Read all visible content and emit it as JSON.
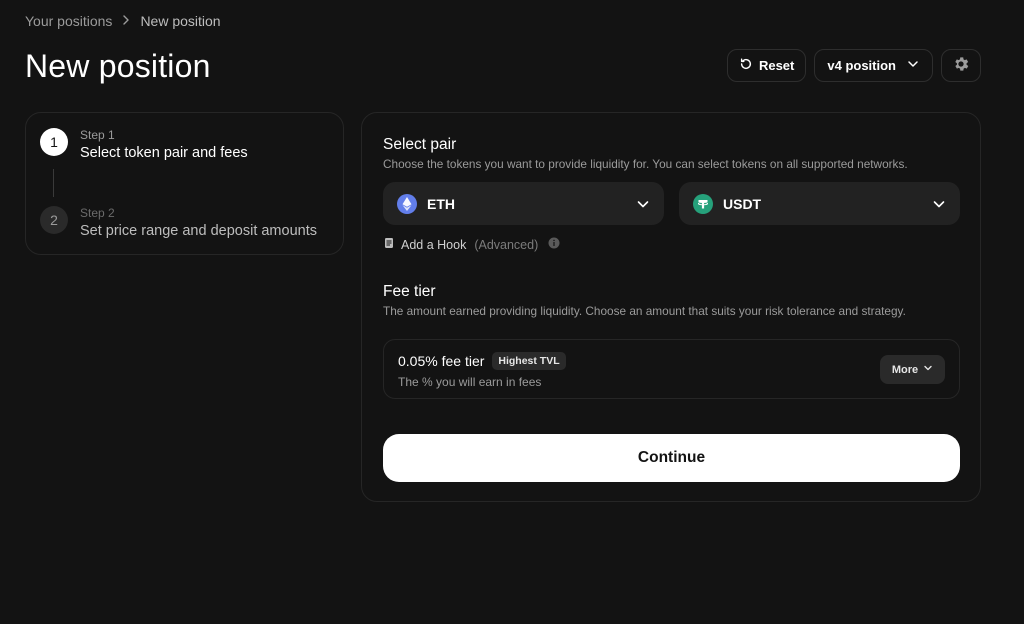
{
  "breadcrumb": {
    "parent": "Your positions",
    "current": "New position"
  },
  "header": {
    "title": "New position",
    "reset_label": "Reset",
    "version_label": "v4 position",
    "settings_icon": "gear-icon"
  },
  "stepper": {
    "steps": [
      {
        "number": "1",
        "label": "Step 1",
        "title": "Select token pair and fees",
        "active": true
      },
      {
        "number": "2",
        "label": "Step 2",
        "title": "Set price range and deposit amounts",
        "active": false
      }
    ]
  },
  "select_pair": {
    "title": "Select pair",
    "description": "Choose the tokens you want to provide liquidity for. You can select tokens on all supported networks.",
    "token_a": {
      "symbol": "ETH",
      "icon": "eth-icon",
      "color": "#627EEA"
    },
    "token_b": {
      "symbol": "USDT",
      "icon": "tether-icon",
      "color": "#26A17B"
    },
    "hook_label": "Add a Hook",
    "hook_hint": "(Advanced)"
  },
  "fee_tier": {
    "title": "Fee tier",
    "description": "The amount earned providing liquidity. Choose an amount that suits your risk tolerance and strategy.",
    "selected": "0.05% fee tier",
    "badge": "Highest TVL",
    "subtitle": "The % you will earn in fees",
    "more_label": "More"
  },
  "continue_label": "Continue"
}
